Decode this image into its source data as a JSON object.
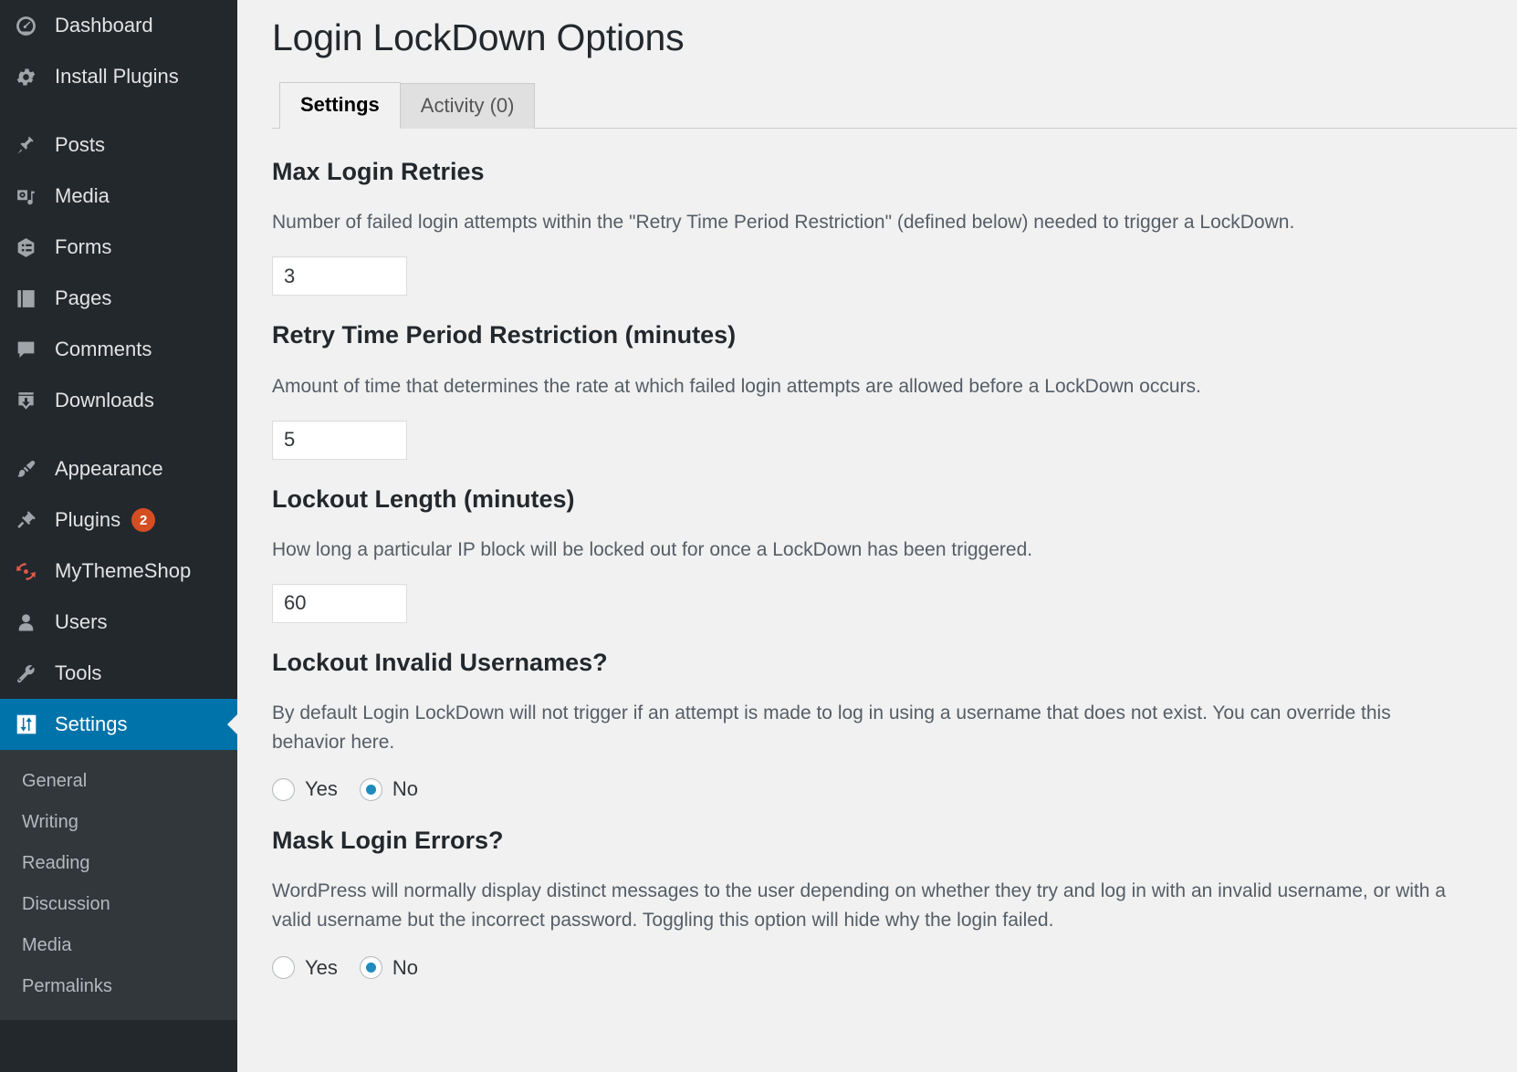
{
  "sidebar": {
    "groups": [
      {
        "items": [
          {
            "label": "Dashboard",
            "icon": "dashboard-icon",
            "current": false
          },
          {
            "label": "Install Plugins",
            "icon": "gear-icon",
            "current": false
          }
        ]
      },
      {
        "items": [
          {
            "label": "Posts",
            "icon": "pin-icon",
            "current": false
          },
          {
            "label": "Media",
            "icon": "media-icon",
            "current": false
          },
          {
            "label": "Forms",
            "icon": "forms-icon",
            "current": false
          },
          {
            "label": "Pages",
            "icon": "pages-icon",
            "current": false
          },
          {
            "label": "Comments",
            "icon": "comment-icon",
            "current": false
          },
          {
            "label": "Downloads",
            "icon": "download-icon",
            "current": false
          }
        ]
      },
      {
        "items": [
          {
            "label": "Appearance",
            "icon": "paintbrush-icon",
            "current": false
          },
          {
            "label": "Plugins",
            "icon": "plug-icon",
            "current": false,
            "badge": "2"
          },
          {
            "label": "MyThemeShop",
            "icon": "refresh-icon",
            "current": false
          },
          {
            "label": "Users",
            "icon": "user-icon",
            "current": false
          },
          {
            "label": "Tools",
            "icon": "wrench-icon",
            "current": false
          },
          {
            "label": "Settings",
            "icon": "settings-sliders-icon",
            "current": true
          }
        ]
      }
    ],
    "submenu": [
      {
        "label": "General"
      },
      {
        "label": "Writing"
      },
      {
        "label": "Reading"
      },
      {
        "label": "Discussion"
      },
      {
        "label": "Media"
      },
      {
        "label": "Permalinks"
      }
    ],
    "colors": {
      "background": "#23282d",
      "submenu_background": "#32373c",
      "current_highlight": "#0073aa",
      "badge": "#d54e21",
      "mythemeshop_icon": "#e35b4a"
    }
  },
  "page": {
    "title": "Login LockDown Options"
  },
  "tabs": [
    {
      "label": "Settings",
      "active": true
    },
    {
      "label": "Activity (0)",
      "active": false
    }
  ],
  "sections": {
    "max_login_retries": {
      "title": "Max Login Retries",
      "description": "Number of failed login attempts within the \"Retry Time Period Restriction\" (defined below) needed to trigger a LockDown.",
      "value": "3"
    },
    "retry_time_period": {
      "title": "Retry Time Period Restriction (minutes)",
      "description": "Amount of time that determines the rate at which failed login attempts are allowed before a LockDown occurs.",
      "value": "5"
    },
    "lockout_length": {
      "title": "Lockout Length (minutes)",
      "description": "How long a particular IP block will be locked out for once a LockDown has been triggered.",
      "value": "60"
    },
    "lockout_invalid_usernames": {
      "title": "Lockout Invalid Usernames?",
      "description": "By default Login LockDown will not trigger if an attempt is made to log in using a username that does not exist. You can override this behavior here.",
      "options": [
        {
          "label": "Yes",
          "selected": false
        },
        {
          "label": "No",
          "selected": true
        }
      ]
    },
    "mask_login_errors": {
      "title": "Mask Login Errors?",
      "description": "WordPress will normally display distinct messages to the user depending on whether they try and log in with an invalid username, or with a valid username but the incorrect password. Toggling this option will hide why the login failed.",
      "options": [
        {
          "label": "Yes",
          "selected": false
        },
        {
          "label": "No",
          "selected": true
        }
      ]
    }
  },
  "theme": {
    "accent": "#0073aa",
    "radio_selected": "#1e8cbe",
    "page_background": "#f1f1f1"
  }
}
